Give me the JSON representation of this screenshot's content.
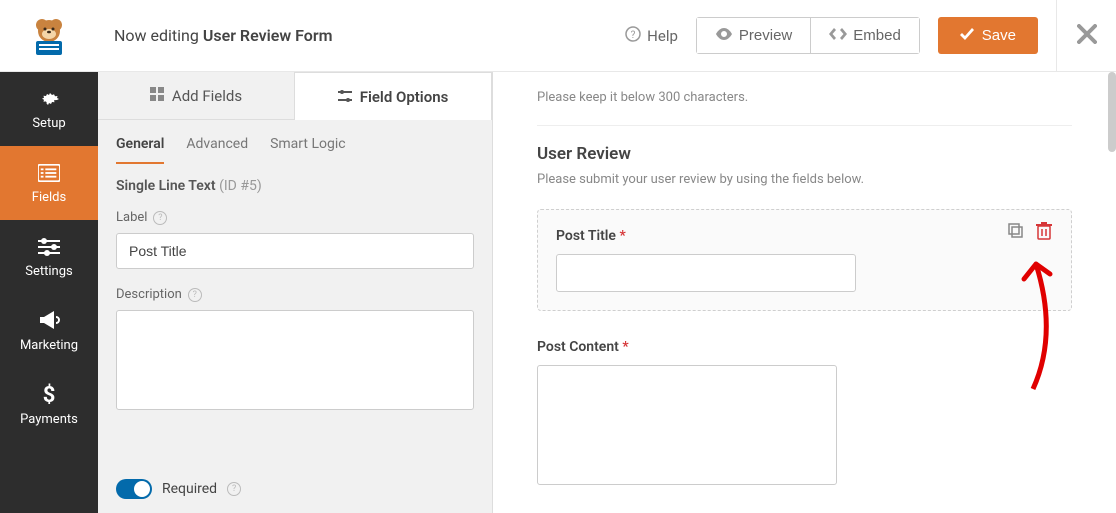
{
  "topbar": {
    "title_prefix": "Now editing",
    "title_name": "User Review Form",
    "help": "Help",
    "preview": "Preview",
    "embed": "Embed",
    "save": "Save"
  },
  "sidebar": {
    "items": [
      {
        "label": "Setup",
        "icon": "gear"
      },
      {
        "label": "Fields",
        "icon": "list"
      },
      {
        "label": "Settings",
        "icon": "sliders"
      },
      {
        "label": "Marketing",
        "icon": "bullhorn"
      },
      {
        "label": "Payments",
        "icon": "dollar"
      }
    ]
  },
  "panel": {
    "tabs": {
      "add_fields": "Add Fields",
      "field_options": "Field Options"
    },
    "subtabs": {
      "general": "General",
      "advanced": "Advanced",
      "smart_logic": "Smart Logic"
    },
    "field_type": "Single Line Text",
    "field_id": "(ID #5)",
    "label_label": "Label",
    "label_value": "Post Title",
    "description_label": "Description",
    "description_value": "",
    "required_label": "Required"
  },
  "preview": {
    "top_note": "Please keep it below 300 characters.",
    "section_title": "User Review",
    "section_desc": "Please submit your user review by using the fields below.",
    "fields": [
      {
        "label": "Post Title",
        "required": "*"
      },
      {
        "label": "Post Content",
        "required": "*"
      }
    ]
  }
}
